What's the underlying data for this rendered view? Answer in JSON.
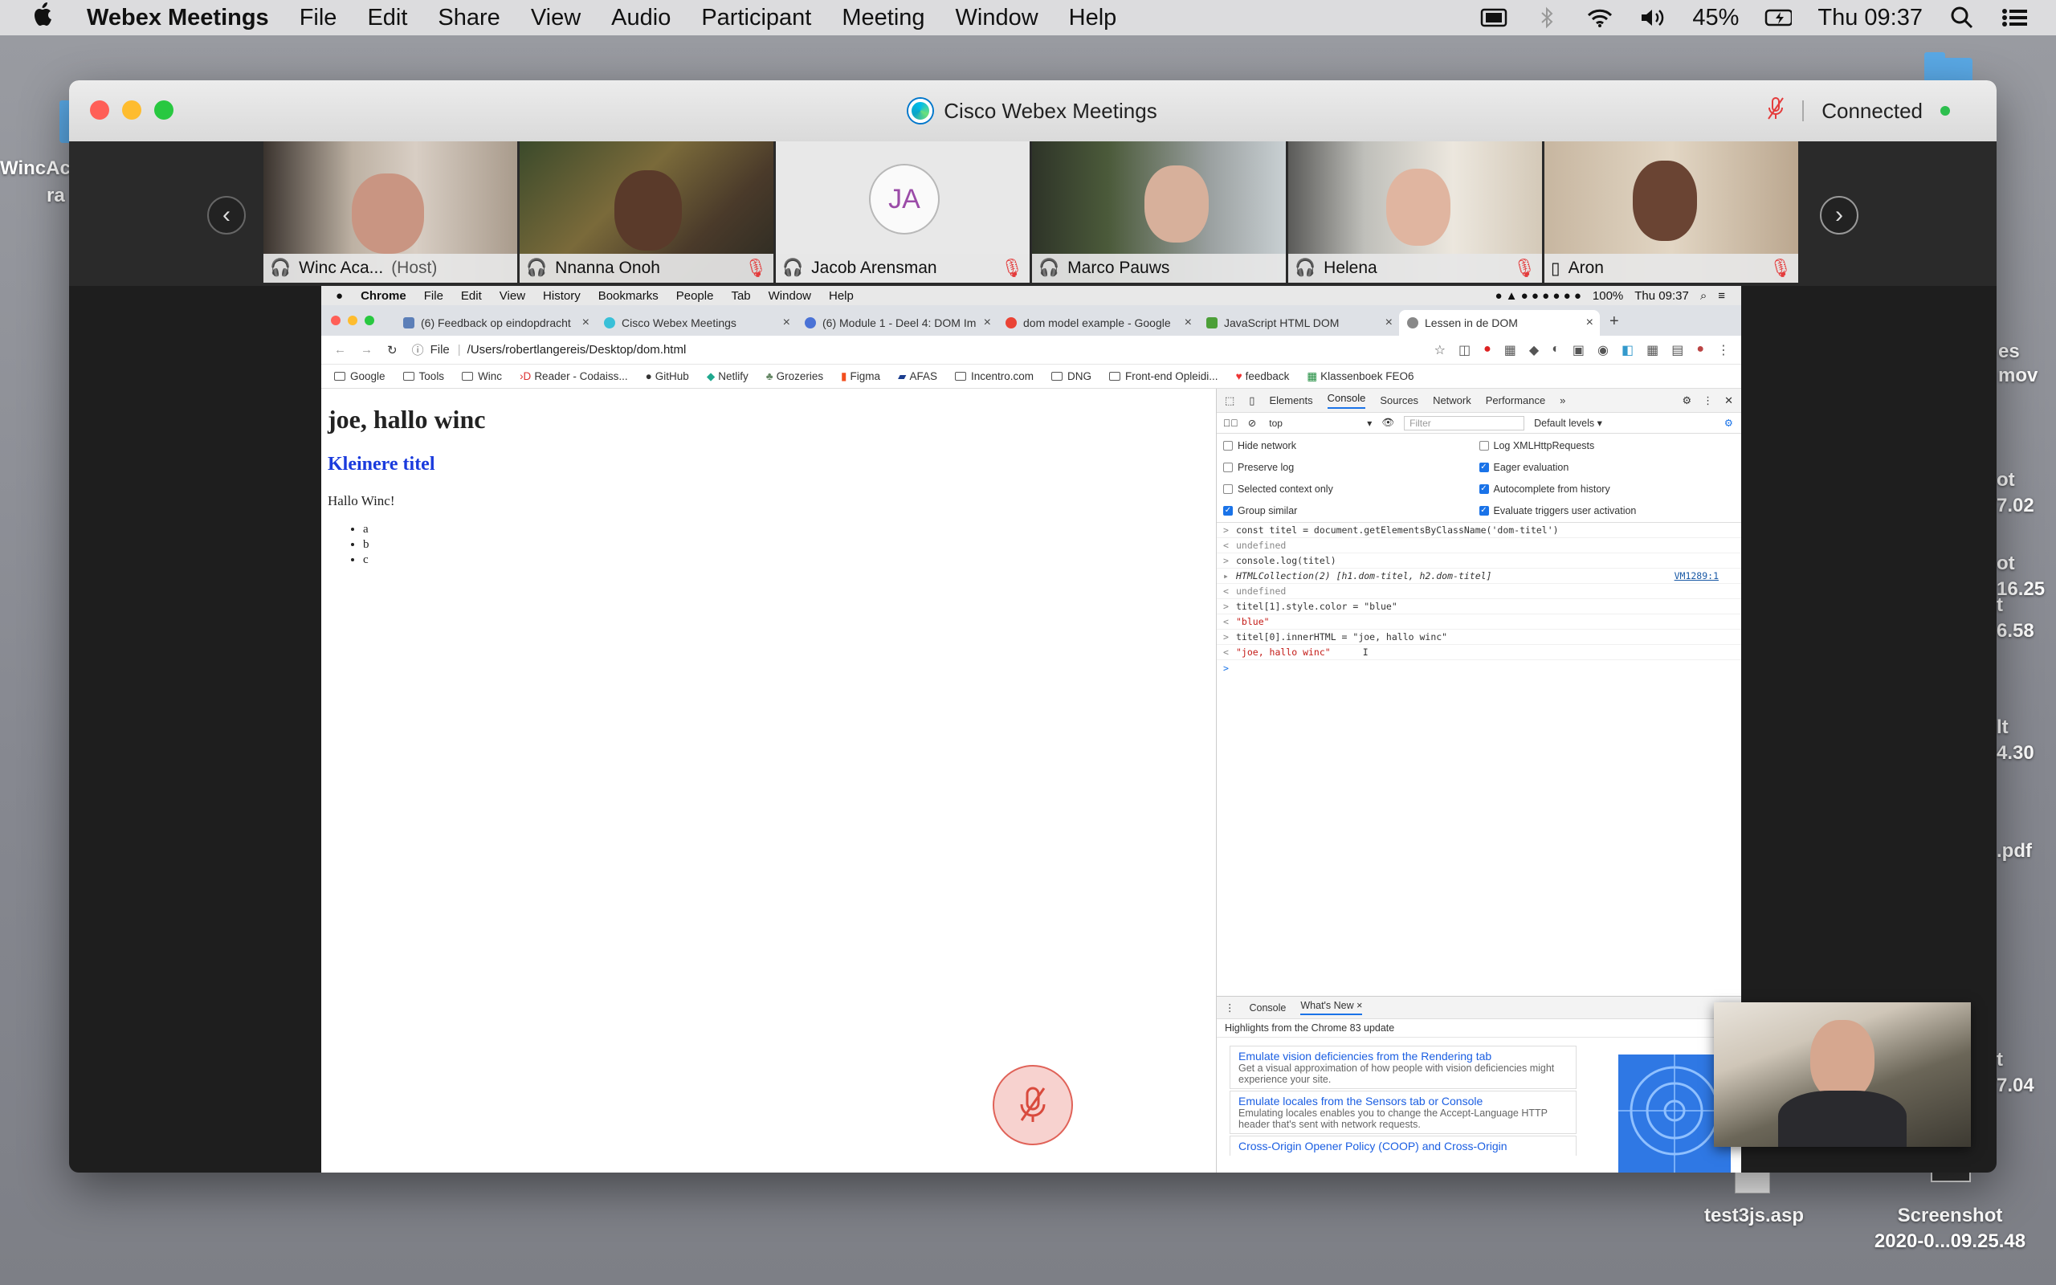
{
  "menubar": {
    "app": "Webex Meetings",
    "items": [
      "File",
      "Edit",
      "Share",
      "View",
      "Audio",
      "Participant",
      "Meeting",
      "Window",
      "Help"
    ],
    "battery": "45%",
    "clock": "Thu 09:37"
  },
  "webex": {
    "title": "Cisco Webex Meetings",
    "status": "Connected",
    "accent": "#2fb0e6",
    "participants": [
      {
        "name": "Winc Aca...",
        "role": "(Host)",
        "active": true,
        "muted": false
      },
      {
        "name": "Nnanna Onoh",
        "active": false,
        "muted": true
      },
      {
        "name": "Jacob Arensman",
        "initials": "JA",
        "active": false,
        "muted": true
      },
      {
        "name": "Marco Pauws",
        "active": true,
        "muted": false
      },
      {
        "name": "Helena",
        "active": false,
        "muted": true
      },
      {
        "name": "Aron",
        "active": false,
        "muted": true
      }
    ]
  },
  "desktop": {
    "left_labels": [
      "WincAc",
      "ra"
    ],
    "right_labels": [
      "es",
      "mov",
      "ot",
      "7.02",
      "ot",
      "16.25",
      "t",
      "6.58",
      "lt",
      "4.30",
      ".pdf",
      "t",
      "7.04"
    ],
    "file1": "test3js.asp",
    "file2_line1": "Screenshot",
    "file2_line2": "2020-0...09.25.48"
  },
  "chrome": {
    "menubar": [
      "Chrome",
      "File",
      "Edit",
      "View",
      "History",
      "Bookmarks",
      "People",
      "Tab",
      "Window",
      "Help"
    ],
    "battery": "100%",
    "clock": "Thu 09:37",
    "tabs": [
      {
        "label": "(6) Feedback op eindopdracht"
      },
      {
        "label": "Cisco Webex Meetings"
      },
      {
        "label": "(6) Module 1 - Deel 4: DOM Im"
      },
      {
        "label": "dom model example - Google"
      },
      {
        "label": "JavaScript HTML DOM"
      },
      {
        "label": "Lessen in de DOM"
      }
    ],
    "address_scheme": "File",
    "address_url": "/Users/robertlangereis/Desktop/dom.html",
    "bookmarks": [
      "Google",
      "Tools",
      "Winc",
      "Reader - Codaiss...",
      "GitHub",
      "Netlify",
      "Grozeries",
      "Figma",
      "AFAS",
      "Incentro.com",
      "DNG",
      "Front-end Opleidi...",
      "feedback",
      "Klassenboek FEO6"
    ]
  },
  "page": {
    "h1": "joe, hallo winc",
    "h2": "Kleinere titel",
    "p": "Hallo Winc!",
    "list": [
      "a",
      "b",
      "c"
    ]
  },
  "devtools": {
    "tabs": [
      "Elements",
      "Console",
      "Sources",
      "Network",
      "Performance"
    ],
    "context": "top",
    "filter_placeholder": "Filter",
    "levels": "Default levels",
    "settings_left": [
      {
        "label": "Hide network",
        "checked": false
      },
      {
        "label": "Preserve log",
        "checked": false
      },
      {
        "label": "Selected context only",
        "checked": false
      },
      {
        "label": "Group similar",
        "checked": true
      }
    ],
    "settings_right": [
      {
        "label": "Log XMLHttpRequests",
        "checked": false
      },
      {
        "label": "Eager evaluation",
        "checked": true
      },
      {
        "label": "Autocomplete from history",
        "checked": true
      },
      {
        "label": "Evaluate triggers user activation",
        "checked": true
      }
    ],
    "console": [
      {
        "prefix": ">",
        "text": "const titel = document.getElementsByClassName('dom-titel')"
      },
      {
        "prefix": "<",
        "text": "undefined",
        "kind": "gray"
      },
      {
        "prefix": ">",
        "text": "console.log(titel)"
      },
      {
        "prefix": "▸",
        "text": "HTMLCollection(2) [h1.dom-titel, h2.dom-titel]",
        "kind": "italic",
        "link": "VM1289:1"
      },
      {
        "prefix": "<",
        "text": "undefined",
        "kind": "gray"
      },
      {
        "prefix": ">",
        "text": "titel[1].style.color = \"blue\""
      },
      {
        "prefix": "<",
        "text": "\"blue\"",
        "kind": "str"
      },
      {
        "prefix": ">",
        "text": "titel[0].innerHTML = \"joe, hallo winc\""
      },
      {
        "prefix": "<",
        "text": "\"joe, hallo winc\"",
        "kind": "str"
      },
      {
        "prefix": ">",
        "text": ""
      }
    ],
    "drawer_tabs": [
      "Console",
      "What's New"
    ],
    "drawer_headline": "Highlights from the Chrome 83 update",
    "cards": [
      {
        "title": "Emulate vision deficiencies from the Rendering tab",
        "desc": "Get a visual approximation of how people with vision deficiencies might experience your site."
      },
      {
        "title": "Emulate locales from the Sensors tab or Console",
        "desc": "Emulating locales enables you to change the Accept-Language HTTP header that's sent with network requests."
      },
      {
        "title": "Cross-Origin Opener Policy (COOP) and Cross-Origin",
        "desc": ""
      }
    ]
  }
}
